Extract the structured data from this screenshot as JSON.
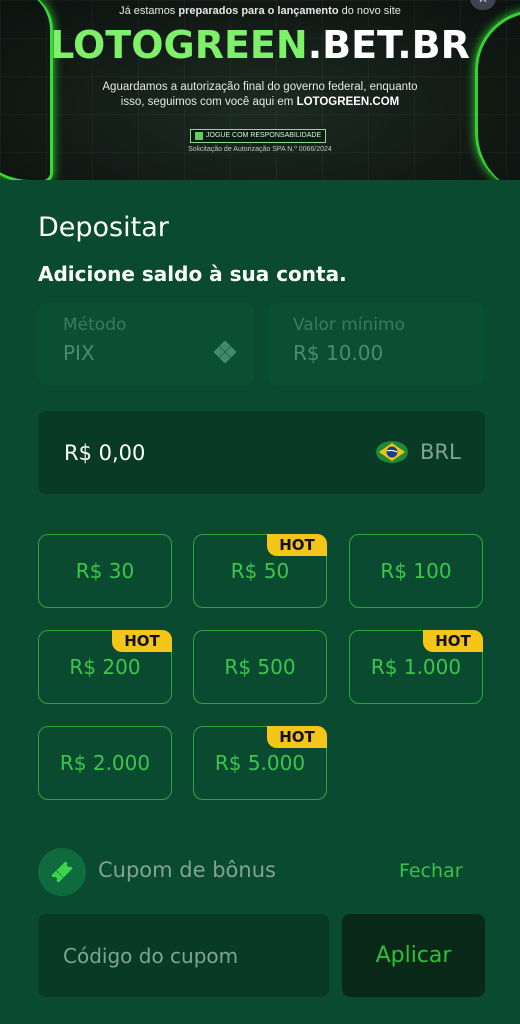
{
  "banner": {
    "top_text_pre": "Já estamos ",
    "top_text_bold": "preparados para o lançamento",
    "top_text_post": " do novo site",
    "logo_green": "LOTOGREEN",
    "logo_white": ".BET.BR",
    "sub_line1": "Aguardamos a autorização final do governo federal, enquanto",
    "sub_line2_pre": "isso, seguimos com você aqui em ",
    "sub_line2_bold": "LOTOGREEN.COM",
    "responsible_badge": "JOGUE COM RESPONSABILIDADE",
    "authorization": "Solicitação de Autorização SPA N.º 0066/2024"
  },
  "deposit": {
    "title": "Depositar",
    "subtitle": "Adicione saldo à sua conta.",
    "method_label": "Método",
    "method_value": "PIX",
    "min_label": "Valor mínimo",
    "min_value": "R$ 10.00",
    "amount_value": "R$ 0,00",
    "currency": "BRL"
  },
  "chips": [
    {
      "label": "R$ 30",
      "hot": ""
    },
    {
      "label": "R$ 50",
      "hot": "HOT"
    },
    {
      "label": "R$ 100",
      "hot": ""
    },
    {
      "label": "R$ 200",
      "hot": "HOT"
    },
    {
      "label": "R$ 500",
      "hot": ""
    },
    {
      "label": "R$ 1.000",
      "hot": "HOT"
    },
    {
      "label": "R$ 2.000",
      "hot": ""
    },
    {
      "label": "R$ 5.000",
      "hot": "HOT"
    }
  ],
  "coupon": {
    "label": "Cupom de bônus",
    "close": "Fechar",
    "placeholder": "Código do cupom",
    "apply": "Aplicar"
  },
  "colors": {
    "background": "#0a4a31",
    "accent_green": "#3cc64a",
    "hot_badge": "#f5c518"
  },
  "icons": {
    "method": "diamond-icon",
    "currency": "brazil-flag-icon",
    "coupon": "ticket-icon"
  }
}
